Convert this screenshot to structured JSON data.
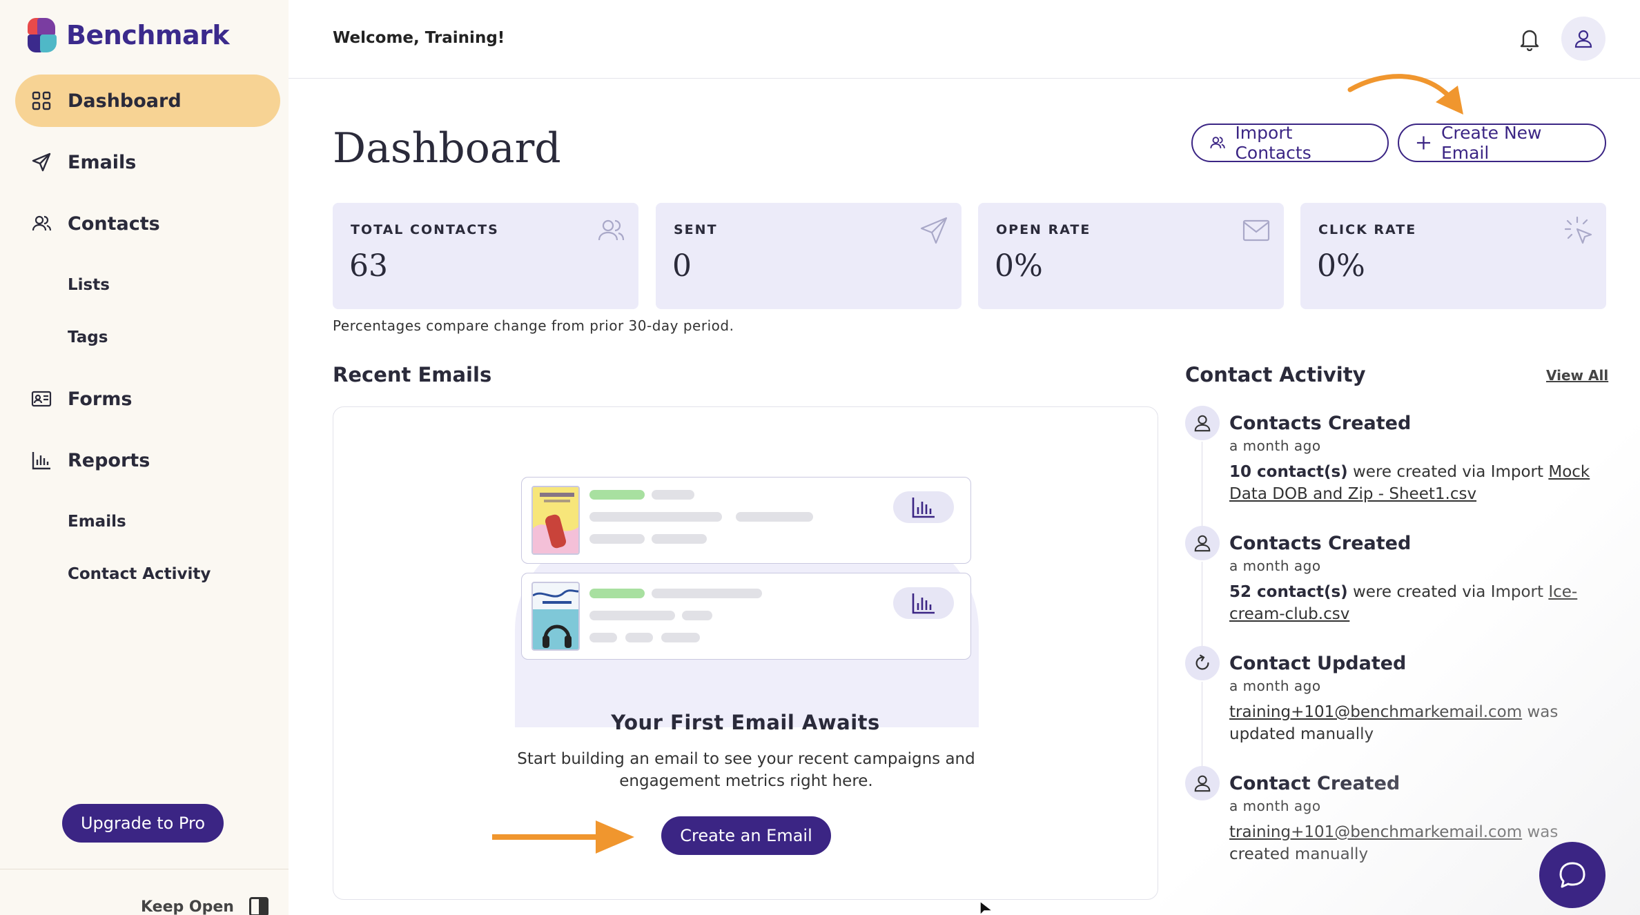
{
  "sidebar": {
    "brand": "Benchmark",
    "items": [
      {
        "label": "Dashboard",
        "icon": "grid-icon",
        "active": true
      },
      {
        "label": "Emails",
        "icon": "paper-plane-icon"
      },
      {
        "label": "Contacts",
        "icon": "users-icon"
      },
      {
        "label": "Lists",
        "sub": true
      },
      {
        "label": "Tags",
        "sub": true
      },
      {
        "label": "Forms",
        "icon": "id-card-icon"
      },
      {
        "label": "Reports",
        "icon": "bar-chart-icon"
      },
      {
        "label": "Emails",
        "sub": true
      },
      {
        "label": "Contact Activity",
        "sub": true
      }
    ],
    "upgrade_label": "Upgrade to Pro",
    "keep_open_label": "Keep Open"
  },
  "header": {
    "welcome": "Welcome, Training!"
  },
  "main": {
    "title": "Dashboard",
    "import_label": "Import Contacts",
    "create_new_label": "Create New Email",
    "stats": [
      {
        "label": "TOTAL CONTACTS",
        "value": "63",
        "icon": "users-icon"
      },
      {
        "label": "SENT",
        "value": "0",
        "icon": "paper-plane-icon"
      },
      {
        "label": "OPEN RATE",
        "value": "0%",
        "icon": "envelope-icon"
      },
      {
        "label": "CLICK RATE",
        "value": "0%",
        "icon": "cursor-click-icon"
      }
    ],
    "note": "Percentages compare change from prior 30-day period.",
    "recent_emails_title": "Recent Emails",
    "empty": {
      "title": "Your First Email Awaits",
      "text": "Start building an email to see your recent campaigns and engagement metrics right here.",
      "button": "Create an Email"
    }
  },
  "activity": {
    "title": "Contact Activity",
    "view_all": "View All",
    "items": [
      {
        "title": "Contacts Created",
        "time": "a month ago",
        "bold": "10 contact(s)",
        "text": " were created via Import ",
        "link": "Mock Data DOB and Zip - Sheet1.csv",
        "tail": "",
        "icon": "user-icon"
      },
      {
        "title": "Contacts Created",
        "time": "a month ago",
        "bold": "52 contact(s)",
        "text": " were created via Import ",
        "link": "Ice-cream-club.csv",
        "tail": "",
        "icon": "user-icon"
      },
      {
        "title": "Contact Updated",
        "time": "a month ago",
        "bold": "",
        "text": "",
        "link": "training+101@benchmarkemail.com",
        "tail": " was updated manually",
        "icon": "refresh-icon"
      },
      {
        "title": "Contact Created",
        "time": "a month ago",
        "bold": "",
        "text": "",
        "link": "training+101@benchmarkemail.com",
        "tail": " was created manually",
        "icon": "user-icon"
      }
    ]
  },
  "colors": {
    "brand": "#3b2584",
    "active_nav": "#f7d394",
    "stat_bg": "#ecebf9",
    "accent_arrow": "#f0962e"
  }
}
